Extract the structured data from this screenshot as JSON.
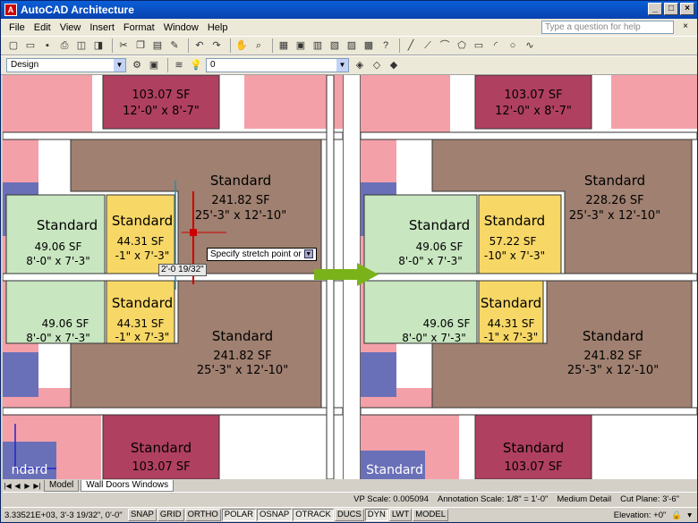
{
  "window": {
    "title": "AutoCAD Architecture",
    "minimize": "_",
    "maximize": "□",
    "close": "×"
  },
  "menu": [
    "File",
    "Edit",
    "View",
    "Insert",
    "Format",
    "Window",
    "Help"
  ],
  "help_search": {
    "placeholder": "Type a question for help"
  },
  "toolbar2": {
    "workspace": "Design",
    "layer": "0"
  },
  "rooms_left": {
    "top_room": {
      "area": "103.07 SF",
      "dims": "12'-0\" x 8'-7\""
    },
    "upper_standard": {
      "name": "Standard",
      "area": "241.82 SF",
      "dims": "25'-3\" x 12'-10\""
    },
    "upper_bath": {
      "name": "Standard",
      "area": "49.06 SF",
      "dims": "8'-0\" x 7'-3\""
    },
    "upper_closet": {
      "name": "Standard",
      "area": "44.31 SF",
      "dims": "-1\" x 7'-3\""
    },
    "lower_closet": {
      "name": "Standard",
      "area": "44.31 SF",
      "dims": "-1\" x 7'-3\""
    },
    "lower_bath": {
      "area": "49.06 SF",
      "dims": "8'-0\" x 7'-3\""
    },
    "lower_standard": {
      "name": "Standard",
      "area": "241.82 SF",
      "dims": "25'-3\" x 12'-10\""
    },
    "bottom_room": {
      "name": "Standard",
      "area": "103.07 SF"
    },
    "blue_room_label": "ndard"
  },
  "rooms_right": {
    "top_room": {
      "area": "103.07 SF",
      "dims": "12'-0\" x 8'-7\""
    },
    "upper_standard": {
      "name": "Standard",
      "area": "228.26 SF",
      "dims": "25'-3\" x 12'-10\""
    },
    "upper_bath": {
      "name": "Standard",
      "area": "49.06 SF",
      "dims": "8'-0\" x 7'-3\""
    },
    "upper_closet": {
      "name": "Standard",
      "area": "57.22 SF",
      "dims": "-10\" x 7'-3\""
    },
    "lower_closet": {
      "name": "Standard",
      "area": "44.31 SF",
      "dims": "-1\" x 7'-3\""
    },
    "lower_bath": {
      "area": "49.06 SF",
      "dims": "8'-0\" x 7'-3\""
    },
    "lower_standard": {
      "name": "Standard",
      "area": "241.82 SF",
      "dims": "25'-3\" x 12'-10\""
    },
    "bottom_room": {
      "name": "Standard",
      "area": "103.07 SF"
    },
    "blue_room_label": "Standard"
  },
  "tooltip": {
    "text": "Specify stretch point or"
  },
  "dimension_input": "2'-0 19/32\"",
  "tabs": [
    "Model",
    "Wall Doors Windows"
  ],
  "status1": {
    "vp_scale": "VP Scale:  0.005094",
    "annotation_scale": "Annotation Scale:  1/8\" = 1'-0\"",
    "detail": "Medium Detail",
    "cut_plane": "Cut Plane:  3'-6\""
  },
  "status2": {
    "coords": "3.33521E+03, 3'-3 19/32\", 0'-0\"",
    "buttons": [
      "SNAP",
      "GRID",
      "ORTHO",
      "POLAR",
      "OSNAP",
      "OTRACK",
      "DUCS",
      "DYN",
      "LWT",
      "MODEL"
    ],
    "elevation": "Elevation:  +0\""
  },
  "colors": {
    "standard_room": "#a08070",
    "bath": "#c8e6c0",
    "closet": "#f7d766",
    "top_room": "#b04060",
    "pink": "#f4a0a8",
    "blue_room": "#6a70b8",
    "arrow": "#7ab319"
  }
}
